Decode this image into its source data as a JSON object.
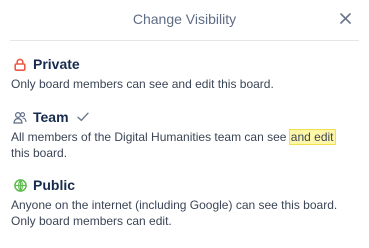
{
  "header": {
    "title": "Change Visibility"
  },
  "icons": {
    "close": "close-icon",
    "private": "lock-icon",
    "team": "team-icon",
    "public": "globe-icon",
    "selected": "checkmark-icon"
  },
  "colors": {
    "private": "#eb5a46",
    "public": "#61bd4f",
    "team": "#5e6c84",
    "highlight": "#fff7a8"
  },
  "options": {
    "private": {
      "label": "Private",
      "description": "Only board members can see and edit this board."
    },
    "team": {
      "label": "Team",
      "selected": true,
      "description_before": "All members of the Digital Humanities team can see ",
      "description_highlight": "and edit",
      "description_after": "this board."
    },
    "public": {
      "label": "Public",
      "description_line1": "Anyone on the internet (including Google) can see this board.",
      "description_line2": "Only board members can edit."
    }
  }
}
